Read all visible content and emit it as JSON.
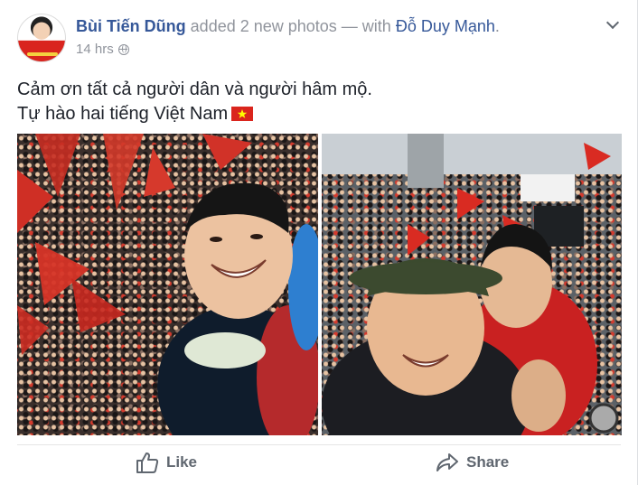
{
  "post": {
    "author": "Bùi Tiến Dũng",
    "action_text": " added 2 new photos — with ",
    "tagged": "Đỗ Duy Mạnh",
    "after_tagged": ".",
    "time": "14 hrs",
    "text_lines": [
      "Cảm ơn tất cả người dân và người hâm mộ.",
      "Tự hào hai tiếng Việt Nam"
    ]
  },
  "actions": {
    "like_label": "Like",
    "share_label": "Share"
  },
  "colors": {
    "link": "#365899",
    "muted": "#90949c",
    "action_text": "#606770",
    "flag_red": "#da251d",
    "flag_star": "#ffff00"
  },
  "icons": [
    "globe-icon",
    "chevron-down-icon",
    "vietnam-flag-icon",
    "like-icon",
    "share-icon"
  ]
}
